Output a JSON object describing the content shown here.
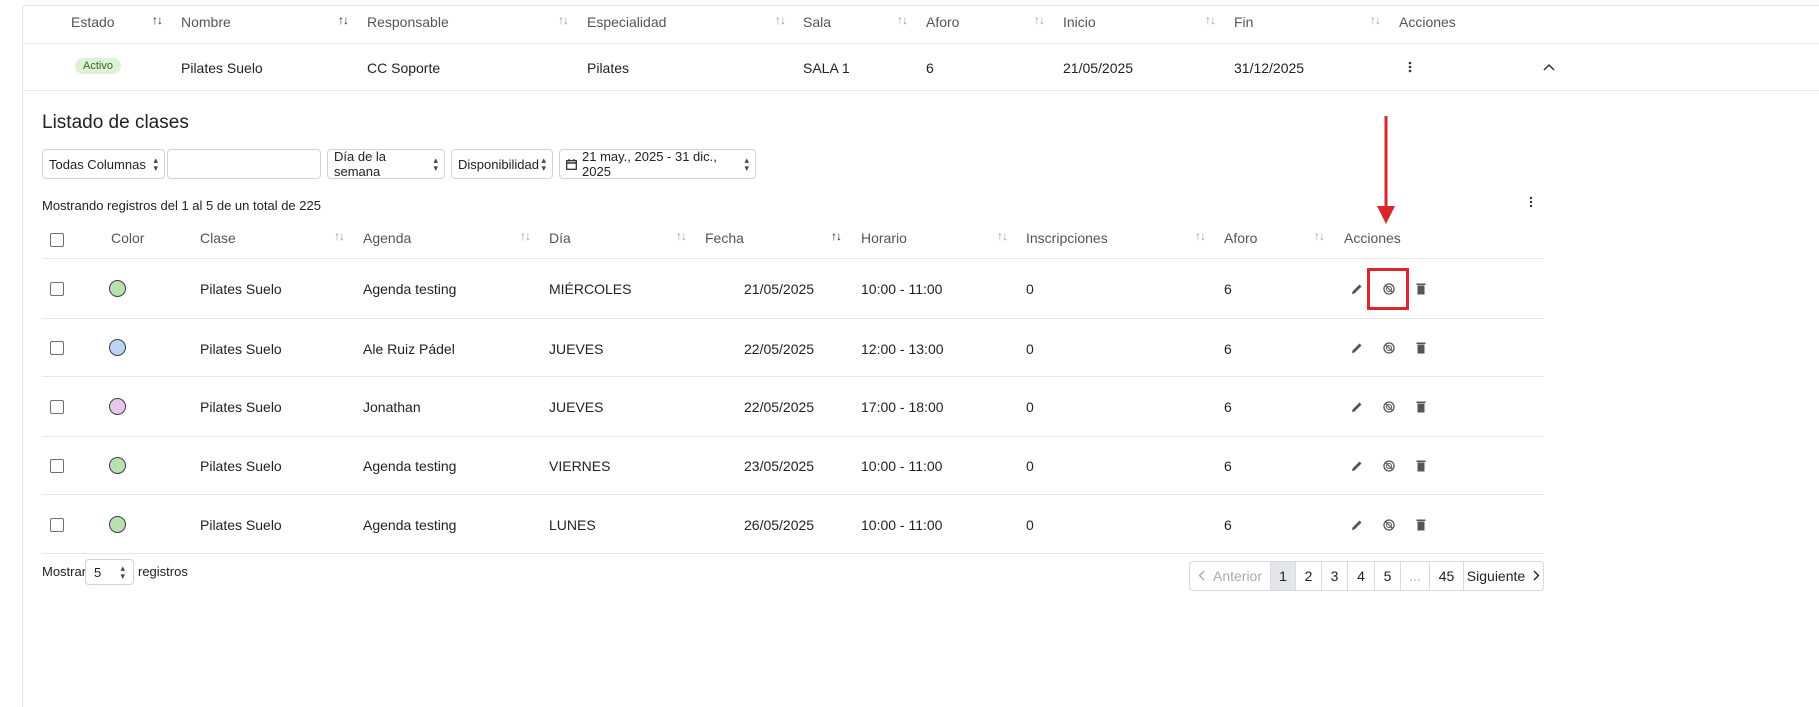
{
  "course_table": {
    "headers": [
      "Estado",
      "Nombre",
      "Responsable",
      "Especialidad",
      "Sala",
      "Aforo",
      "Inicio",
      "Fin",
      "Acciones"
    ],
    "row": {
      "estado": "Activo",
      "nombre": "Pilates Suelo",
      "responsable": "CC Soporte",
      "especialidad": "Pilates",
      "sala": "SALA 1",
      "aforo": "6",
      "inicio": "21/05/2025",
      "fin": "31/12/2025"
    }
  },
  "classes": {
    "title": "Listado de clases",
    "filters": {
      "columns_select": "Todas Columnas",
      "search_value": "",
      "weekday_select": "Día de la semana",
      "availability_select": "Disponibilidad",
      "date_range": "21 may., 2025 - 31 dic., 2025"
    },
    "summary": "Mostrando registros del 1 al 5 de un total de 225",
    "headers": [
      "Color",
      "Clase",
      "Agenda",
      "Día",
      "Fecha",
      "Horario",
      "Inscripciones",
      "Aforo",
      "Acciones"
    ],
    "rows": [
      {
        "color": "#b9e0b0",
        "clase": "Pilates Suelo",
        "agenda": "Agenda testing",
        "dia": "MIÉRCOLES",
        "fecha": "21/05/2025",
        "horario": "10:00 - 11:00",
        "inscripciones": "0",
        "aforo": "6"
      },
      {
        "color": "#bcd3f2",
        "clase": "Pilates Suelo",
        "agenda": "Ale Ruiz Pádel",
        "dia": "JUEVES",
        "fecha": "22/05/2025",
        "horario": "12:00 - 13:00",
        "inscripciones": "0",
        "aforo": "6"
      },
      {
        "color": "#e6c9ea",
        "clase": "Pilates Suelo",
        "agenda": "Jonathan",
        "dia": "JUEVES",
        "fecha": "22/05/2025",
        "horario": "17:00 - 18:00",
        "inscripciones": "0",
        "aforo": "6"
      },
      {
        "color": "#b9e0b0",
        "clase": "Pilates Suelo",
        "agenda": "Agenda testing",
        "dia": "VIERNES",
        "fecha": "23/05/2025",
        "horario": "10:00 - 11:00",
        "inscripciones": "0",
        "aforo": "6"
      },
      {
        "color": "#b9e0b0",
        "clase": "Pilates Suelo",
        "agenda": "Agenda testing",
        "dia": "LUNES",
        "fecha": "26/05/2025",
        "horario": "10:00 - 11:00",
        "inscripciones": "0",
        "aforo": "6"
      }
    ],
    "footer": {
      "show_label": "Mostrar",
      "page_size": "5",
      "records_label": "registros"
    },
    "pagination": {
      "prev": "Anterior",
      "pages": [
        "1",
        "2",
        "3",
        "4",
        "5",
        "...",
        "45"
      ],
      "next": "Siguiente"
    }
  },
  "colors": {
    "annotation_red": "#d9262c",
    "badge_bg": "#dff1d6",
    "badge_text": "#2f6b1f"
  },
  "icons": {
    "edit": "pencil-icon",
    "cancel": "cancel-circle-icon",
    "delete": "trash-icon",
    "more": "kebab-icon",
    "collapse": "chevron-up-icon",
    "calendar": "calendar-icon"
  }
}
